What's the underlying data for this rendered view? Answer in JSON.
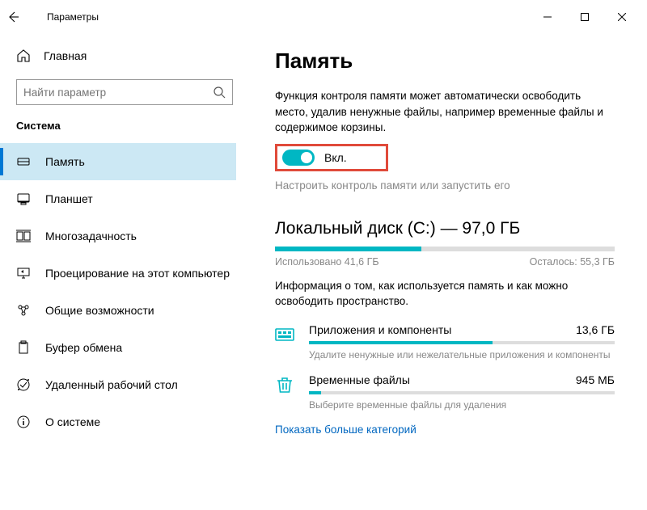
{
  "window": {
    "title": "Параметры"
  },
  "sidebar": {
    "home": "Главная",
    "search_placeholder": "Найти параметр",
    "section": "Система",
    "items": [
      {
        "label": "Память",
        "active": true,
        "icon": "storage"
      },
      {
        "label": "Планшет",
        "active": false,
        "icon": "tablet"
      },
      {
        "label": "Многозадачность",
        "active": false,
        "icon": "multitask"
      },
      {
        "label": "Проецирование на этот компьютер",
        "active": false,
        "icon": "project"
      },
      {
        "label": "Общие возможности",
        "active": false,
        "icon": "shared"
      },
      {
        "label": "Буфер обмена",
        "active": false,
        "icon": "clipboard"
      },
      {
        "label": "Удаленный рабочий стол",
        "active": false,
        "icon": "remote"
      },
      {
        "label": "О системе",
        "active": false,
        "icon": "about"
      }
    ]
  },
  "page": {
    "title": "Память",
    "desc": "Функция контроля памяти может автоматически освободить место, удалив ненужные файлы, например временные файлы и содержимое корзины.",
    "toggle_label": "Вкл.",
    "configure": "Настроить контроль памяти или запустить его",
    "disk": {
      "title": "Локальный диск (C:) — 97,0 ГБ",
      "used_label": "Использовано 41,6 ГБ",
      "free_label": "Осталось: 55,3 ГБ",
      "fill_pct": 43
    },
    "disk_info": "Информация о том, как используется память и как можно освободить пространство.",
    "rows": [
      {
        "label": "Приложения и компоненты",
        "value": "13,6 ГБ",
        "hint": "Удалите ненужные или нежелательные приложения и компоненты",
        "fill_pct": 60,
        "icon": "apps"
      },
      {
        "label": "Временные файлы",
        "value": "945 МБ",
        "hint": "Выберите временные файлы для удаления",
        "fill_pct": 4,
        "icon": "trash"
      }
    ],
    "show_more": "Показать больше категорий"
  }
}
